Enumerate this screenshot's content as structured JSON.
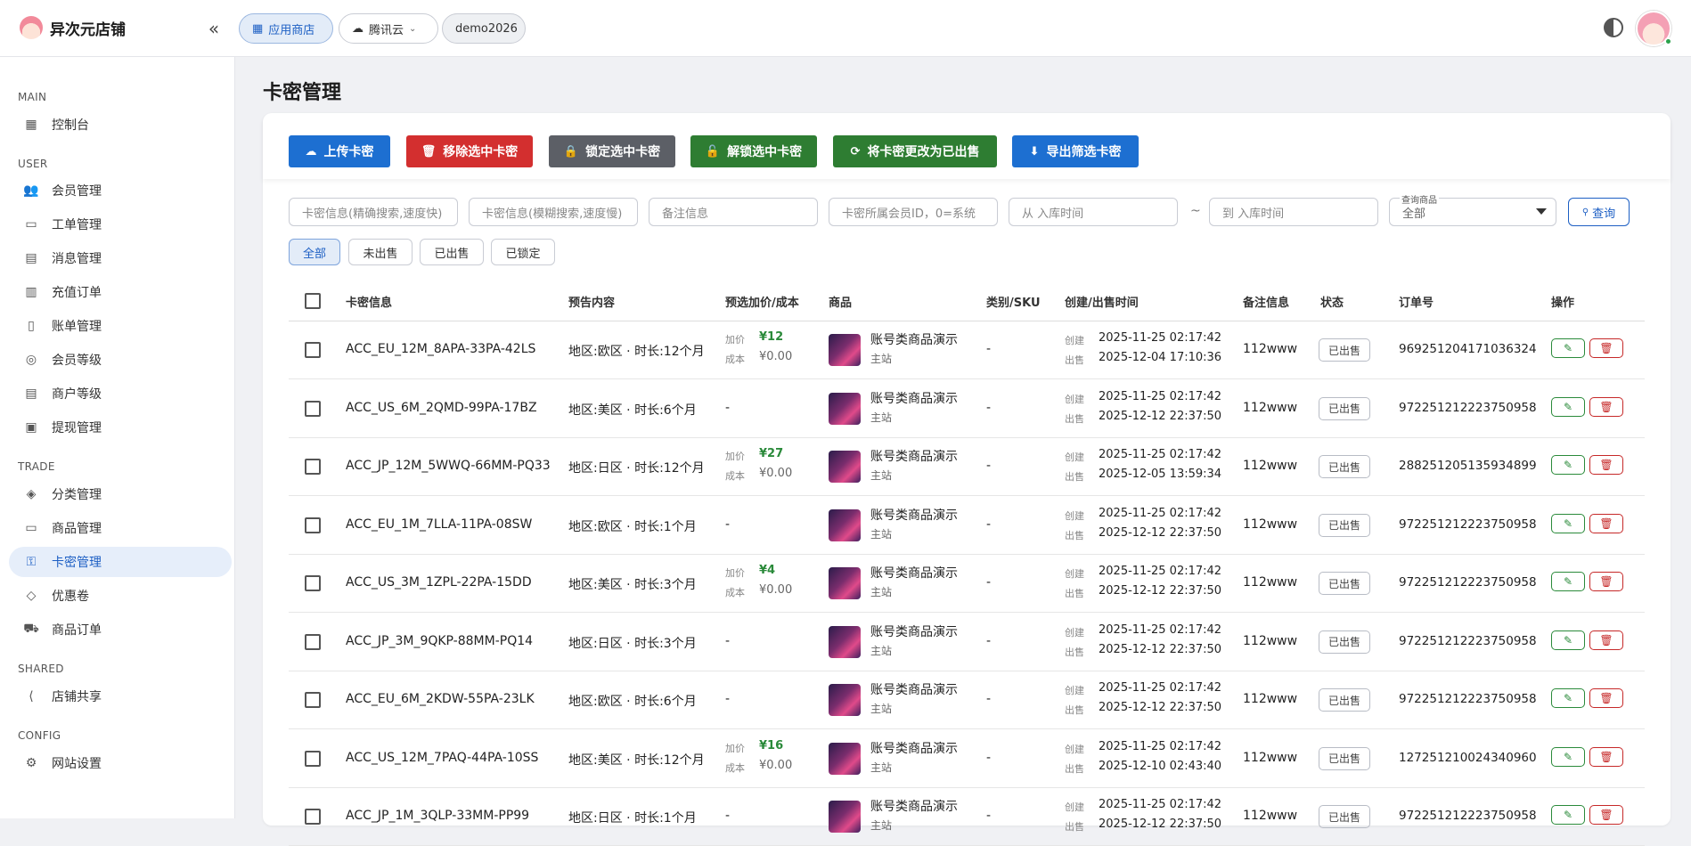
{
  "brand": {
    "name": "异次元店铺"
  },
  "header": {
    "chips": [
      {
        "label": "应用商店",
        "icon": "store-icon"
      },
      {
        "label": "腾讯云",
        "icon": "cloud-icon"
      },
      {
        "label": "demo2026"
      }
    ]
  },
  "sidebar": {
    "sections": [
      "MAIN",
      "USER",
      "TRADE",
      "SHARED",
      "CONFIG"
    ],
    "items": [
      {
        "label": "控制台",
        "icon": "dashboard-icon"
      },
      {
        "label": "会员管理",
        "icon": "users-icon"
      },
      {
        "label": "工单管理",
        "icon": "ticket-icon"
      },
      {
        "label": "消息管理",
        "icon": "message-icon"
      },
      {
        "label": "充值订单",
        "icon": "receipt-icon"
      },
      {
        "label": "账单管理",
        "icon": "bill-icon"
      },
      {
        "label": "会员等级",
        "icon": "badge-icon"
      },
      {
        "label": "商户等级",
        "icon": "shop-icon"
      },
      {
        "label": "提现管理",
        "icon": "wallet-icon"
      },
      {
        "label": "分类管理",
        "icon": "category-icon"
      },
      {
        "label": "商品管理",
        "icon": "archive-icon"
      },
      {
        "label": "卡密管理",
        "icon": "key-icon"
      },
      {
        "label": "优惠卷",
        "icon": "tag-icon"
      },
      {
        "label": "商品订单",
        "icon": "cart-icon"
      },
      {
        "label": "店铺共享",
        "icon": "share-icon"
      },
      {
        "label": "网站设置",
        "icon": "gear-icon"
      }
    ]
  },
  "page": {
    "title": "卡密管理"
  },
  "actions": [
    {
      "label": "上传卡密",
      "color": "#1d6fd1",
      "icon": "upload-cloud-icon"
    },
    {
      "label": "移除选中卡密",
      "color": "#d32f2f",
      "icon": "trash-icon"
    },
    {
      "label": "锁定选中卡密",
      "color": "#5c5f66",
      "icon": "lock-icon"
    },
    {
      "label": "解锁选中卡密",
      "color": "#2e7d32",
      "icon": "unlock-icon"
    },
    {
      "label": "将卡密更改为已出售",
      "color": "#2e7d32",
      "icon": "refresh-icon"
    },
    {
      "label": "导出筛选卡密",
      "color": "#1d6fd1",
      "icon": "download-icon"
    }
  ],
  "filters": {
    "exact_placeholder": "卡密信息(精确搜索,速度快)",
    "fuzzy_placeholder": "卡密信息(模糊搜索,速度慢)",
    "remark_placeholder": "备注信息",
    "member_placeholder": "卡密所属会员ID，0=系统",
    "from_placeholder": "从 入库时间",
    "range_sep": "~",
    "to_placeholder": "到 入库时间",
    "product_label": "查询商品",
    "product_value": "全部",
    "query_label": "查询"
  },
  "tabs": [
    "全部",
    "未出售",
    "已出售",
    "已锁定"
  ],
  "table": {
    "headers": [
      "卡密信息",
      "预告内容",
      "预选加价/成本",
      "商品",
      "类别/SKU",
      "创建/出售时间",
      "备注信息",
      "状态",
      "订单号",
      "操作"
    ],
    "price_label": "加价",
    "cost_label": "成本",
    "create_label": "创建",
    "sold_label": "出售",
    "rows": [
      {
        "card": "ACC_EU_12M_8APA-33PA-42LS",
        "preview": "地区:欧区 · 时长:12个月",
        "price": "¥12",
        "cost": "¥0.00",
        "product": "账号类商品演示",
        "site": "主站",
        "sku": "-",
        "created": "2025-11-25 02:17:42",
        "sold": "2025-12-04 17:10:36",
        "remark": "112www",
        "status": "已出售",
        "order": "969251204171036324"
      },
      {
        "card": "ACC_US_6M_2QMD-99PA-17BZ",
        "preview": "地区:美区 · 时长:6个月",
        "price": "-",
        "cost": "",
        "product": "账号类商品演示",
        "site": "主站",
        "sku": "-",
        "created": "2025-11-25 02:17:42",
        "sold": "2025-12-12 22:37:50",
        "remark": "112www",
        "status": "已出售",
        "order": "972251212223750958"
      },
      {
        "card": "ACC_JP_12M_5WWQ-66MM-PQ33",
        "preview": "地区:日区 · 时长:12个月",
        "price": "¥27",
        "cost": "¥0.00",
        "product": "账号类商品演示",
        "site": "主站",
        "sku": "-",
        "created": "2025-11-25 02:17:42",
        "sold": "2025-12-05 13:59:34",
        "remark": "112www",
        "status": "已出售",
        "order": "288251205135934899"
      },
      {
        "card": "ACC_EU_1M_7LLA-11PA-08SW",
        "preview": "地区:欧区 · 时长:1个月",
        "price": "-",
        "cost": "",
        "product": "账号类商品演示",
        "site": "主站",
        "sku": "-",
        "created": "2025-11-25 02:17:42",
        "sold": "2025-12-12 22:37:50",
        "remark": "112www",
        "status": "已出售",
        "order": "972251212223750958"
      },
      {
        "card": "ACC_US_3M_1ZPL-22PA-15DD",
        "preview": "地区:美区 · 时长:3个月",
        "price": "¥4",
        "cost": "¥0.00",
        "product": "账号类商品演示",
        "site": "主站",
        "sku": "-",
        "created": "2025-11-25 02:17:42",
        "sold": "2025-12-12 22:37:50",
        "remark": "112www",
        "status": "已出售",
        "order": "972251212223750958"
      },
      {
        "card": "ACC_JP_3M_9QKP-88MM-PQ14",
        "preview": "地区:日区 · 时长:3个月",
        "price": "-",
        "cost": "",
        "product": "账号类商品演示",
        "site": "主站",
        "sku": "-",
        "created": "2025-11-25 02:17:42",
        "sold": "2025-12-12 22:37:50",
        "remark": "112www",
        "status": "已出售",
        "order": "972251212223750958"
      },
      {
        "card": "ACC_EU_6M_2KDW-55PA-23LK",
        "preview": "地区:欧区 · 时长:6个月",
        "price": "-",
        "cost": "",
        "product": "账号类商品演示",
        "site": "主站",
        "sku": "-",
        "created": "2025-11-25 02:17:42",
        "sold": "2025-12-12 22:37:50",
        "remark": "112www",
        "status": "已出售",
        "order": "972251212223750958"
      },
      {
        "card": "ACC_US_12M_7PAQ-44PA-10SS",
        "preview": "地区:美区 · 时长:12个月",
        "price": "¥16",
        "cost": "¥0.00",
        "product": "账号类商品演示",
        "site": "主站",
        "sku": "-",
        "created": "2025-11-25 02:17:42",
        "sold": "2025-12-10 02:43:40",
        "remark": "112www",
        "status": "已出售",
        "order": "127251210024340960"
      },
      {
        "card": "ACC_JP_1M_3QLP-33MM-PP99",
        "preview": "地区:日区 · 时长:1个月",
        "price": "-",
        "cost": "",
        "product": "账号类商品演示",
        "site": "主站",
        "sku": "-",
        "created": "2025-11-25 02:17:42",
        "sold": "2025-12-12 22:37:50",
        "remark": "112www",
        "status": "已出售",
        "order": "972251212223750958"
      }
    ]
  }
}
